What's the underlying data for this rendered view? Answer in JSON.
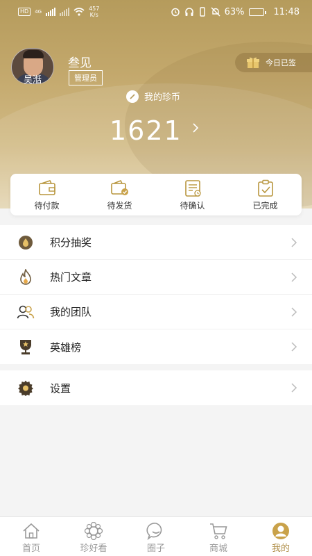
{
  "status_bar": {
    "hd_label": "HD",
    "net_label": "4G",
    "net_speed_value": "457",
    "net_speed_unit": "K/s",
    "battery": "63%",
    "battery_level": 0.63,
    "time": "11:48"
  },
  "profile": {
    "avatar_caption": "吴湉",
    "name": "叁见",
    "role": "管理员",
    "checkin_label": "今日已签"
  },
  "coins": {
    "label": "我的珍币",
    "value": "1621"
  },
  "orders": [
    {
      "label": "待付款",
      "icon": "wallet-icon"
    },
    {
      "label": "待发货",
      "icon": "package-check-icon"
    },
    {
      "label": "待确认",
      "icon": "document-clock-icon"
    },
    {
      "label": "已完成",
      "icon": "clipboard-check-icon"
    }
  ],
  "menu": [
    {
      "label": "积分抽奖",
      "icon": "drop-icon"
    },
    {
      "label": "热门文章",
      "icon": "flame-icon"
    },
    {
      "label": "我的团队",
      "icon": "team-icon"
    },
    {
      "label": "英雄榜",
      "icon": "trophy-icon"
    }
  ],
  "settings": {
    "label": "设置",
    "icon": "gear-icon"
  },
  "tabbar": [
    {
      "label": "首页",
      "icon": "home-icon",
      "active": false
    },
    {
      "label": "珍好看",
      "icon": "flower-icon",
      "active": false
    },
    {
      "label": "圈子",
      "icon": "chat-icon",
      "active": false
    },
    {
      "label": "商城",
      "icon": "cart-icon",
      "active": false
    },
    {
      "label": "我的",
      "icon": "user-icon",
      "active": true
    }
  ],
  "colors": {
    "gold": "#b59b5c",
    "active_tab": "#b08f4a",
    "icon_stroke": "#b8963e"
  }
}
